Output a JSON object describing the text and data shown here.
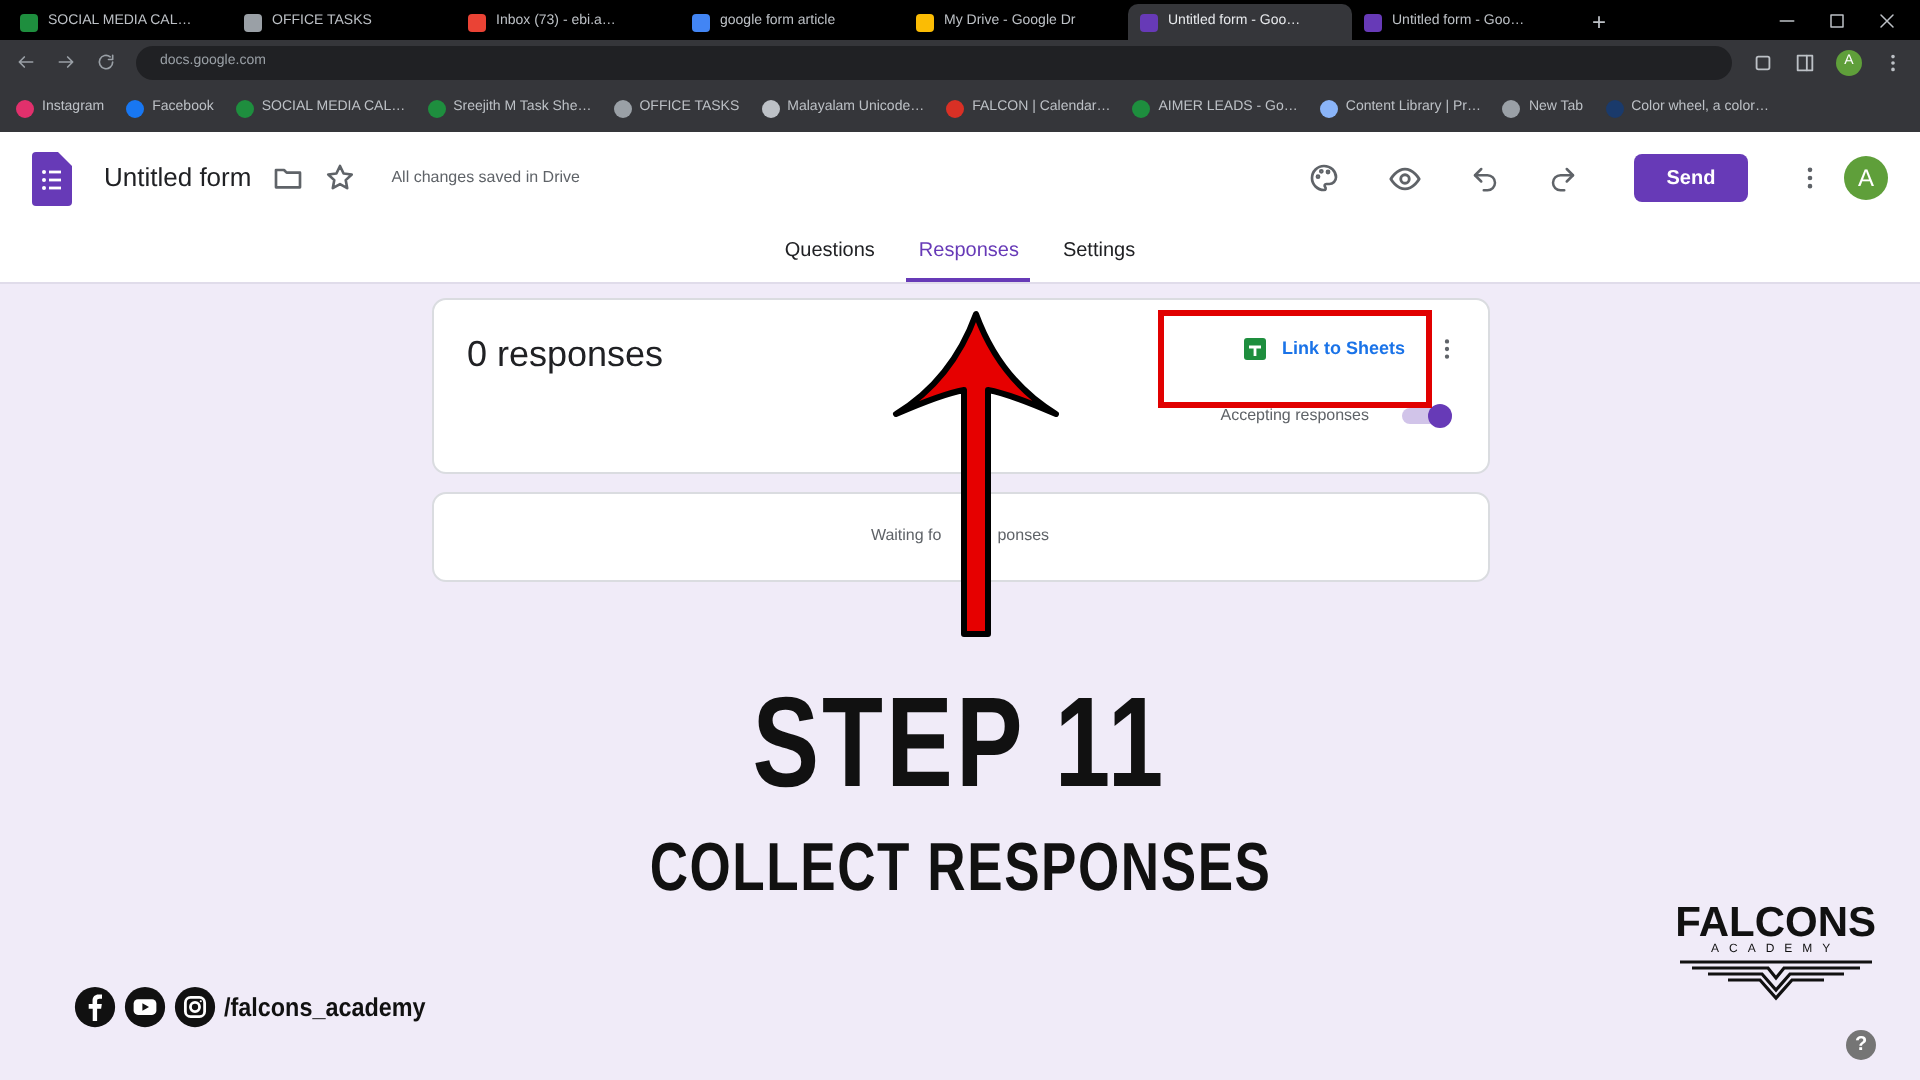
{
  "browser": {
    "tabs": [
      {
        "title": "SOCIAL MEDIA CAL…",
        "color": "#1e8e3e",
        "selected": false
      },
      {
        "title": "OFFICE TASKS",
        "color": "#9aa0a6",
        "selected": false
      },
      {
        "title": "Inbox (73) - ebi.a…",
        "color": "#ea4335",
        "selected": false
      },
      {
        "title": "google form article",
        "color": "#4285f4",
        "selected": false
      },
      {
        "title": "My Drive - Google Dr",
        "color": "#fbbc04",
        "selected": false
      },
      {
        "title": "Untitled form - Goo…",
        "color": "#673ab7",
        "selected": true
      },
      {
        "title": "Untitled form - Goo…",
        "color": "#673ab7",
        "selected": false
      }
    ],
    "new_tab": "+",
    "address": "docs.google.com",
    "bookmarks": [
      {
        "title": "Instagram",
        "color": "#e1306c"
      },
      {
        "title": "Facebook",
        "color": "#1877f2"
      },
      {
        "title": "SOCIAL MEDIA CAL…",
        "color": "#1e8e3e"
      },
      {
        "title": "Sreejith M Task She…",
        "color": "#1e8e3e"
      },
      {
        "title": "OFFICE TASKS",
        "color": "#9aa0a6"
      },
      {
        "title": "Malayalam Unicode…",
        "color": "#bdc1c6"
      },
      {
        "title": "FALCON | Calendar…",
        "color": "#d93025"
      },
      {
        "title": "AIMER LEADS - Go…",
        "color": "#1e8e3e"
      },
      {
        "title": "Content Library | Pr…",
        "color": "#8ab4f8"
      },
      {
        "title": "New Tab",
        "color": "#9aa0a6"
      },
      {
        "title": "Color wheel, a color…",
        "color": "#1a3a6b"
      }
    ],
    "avatar": "A"
  },
  "form": {
    "title": "Untitled form",
    "save_status": "All changes saved in Drive",
    "send": "Send",
    "avatar": "A",
    "tabs": [
      {
        "label": "Questions",
        "selected": false
      },
      {
        "label": "Responses",
        "selected": true
      },
      {
        "label": "Settings",
        "selected": false
      }
    ],
    "summary": {
      "count": "0 responses",
      "link_button": "Link to Sheets",
      "accepting_label": "Accepting responses",
      "accepting": true
    },
    "empty_message_parts": [
      "Waiting fo",
      "ponses"
    ]
  },
  "overlay": {
    "step": "STEP 11",
    "caption": "COLLECT RESPONSES",
    "handle": "/falcons_academy",
    "logo_title": "FALCONS",
    "logo_subtitle": "ACADEMY"
  },
  "help": "?"
}
